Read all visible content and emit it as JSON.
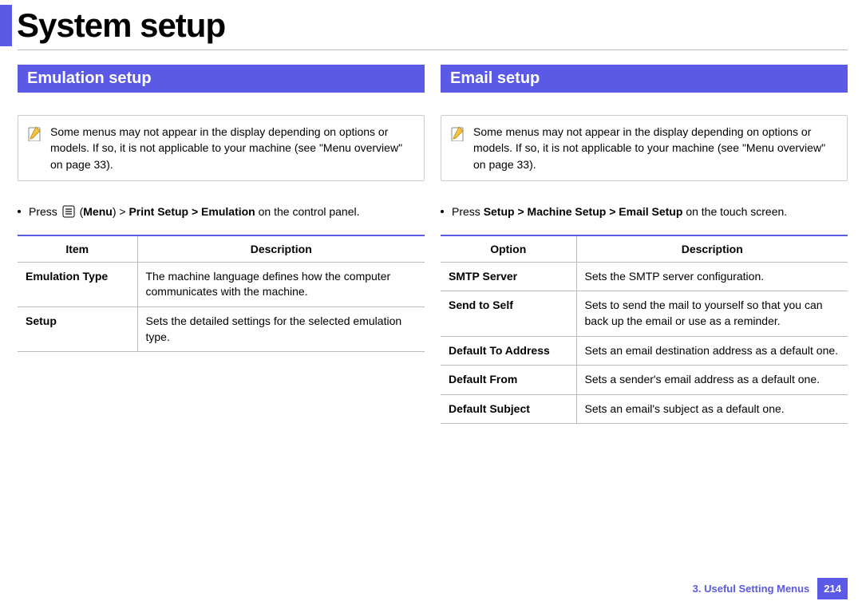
{
  "page": {
    "title": "System setup",
    "footer_chapter": "3.  Useful Setting Menus",
    "footer_page": "214"
  },
  "left": {
    "heading": "Emulation setup",
    "note": "Some menus may not appear in the display depending on options or models. If so, it is not applicable to your machine (see \"Menu overview\" on page 33).",
    "bullet_prefix": "Press ",
    "bullet_icon_alt": "Menu",
    "bullet_menu": "Menu",
    "bullet_path_bold": "Print Setup > Emulation",
    "bullet_suffix": " on the control panel.",
    "table": {
      "head": [
        "Item",
        "Description"
      ],
      "rows": [
        {
          "label": "Emulation Type",
          "desc": "The machine language defines how the computer communicates with the machine."
        },
        {
          "label": "Setup",
          "desc": "Sets the detailed settings for the selected emulation type."
        }
      ]
    }
  },
  "right": {
    "heading": "Email setup",
    "note": "Some menus may not appear in the display depending on options or models. If so, it is not applicable to your machine (see \"Menu overview\" on page 33).",
    "bullet_prefix": "Press ",
    "bullet_path_bold": "Setup > Machine Setup > Email Setup",
    "bullet_suffix": " on the touch screen.",
    "table": {
      "head": [
        "Option",
        "Description"
      ],
      "rows": [
        {
          "label": "SMTP Server",
          "desc": "Sets the SMTP server configuration."
        },
        {
          "label": "Send to Self",
          "desc": "Sets to send the mail to yourself so that you can back up the email or use as a reminder."
        },
        {
          "label": "Default To Address",
          "desc": "Sets an email destination address as a default one."
        },
        {
          "label": "Default From",
          "desc": "Sets a sender's email address as a default one."
        },
        {
          "label": "Default Subject",
          "desc": "Sets an email's subject as a default one."
        }
      ]
    }
  }
}
